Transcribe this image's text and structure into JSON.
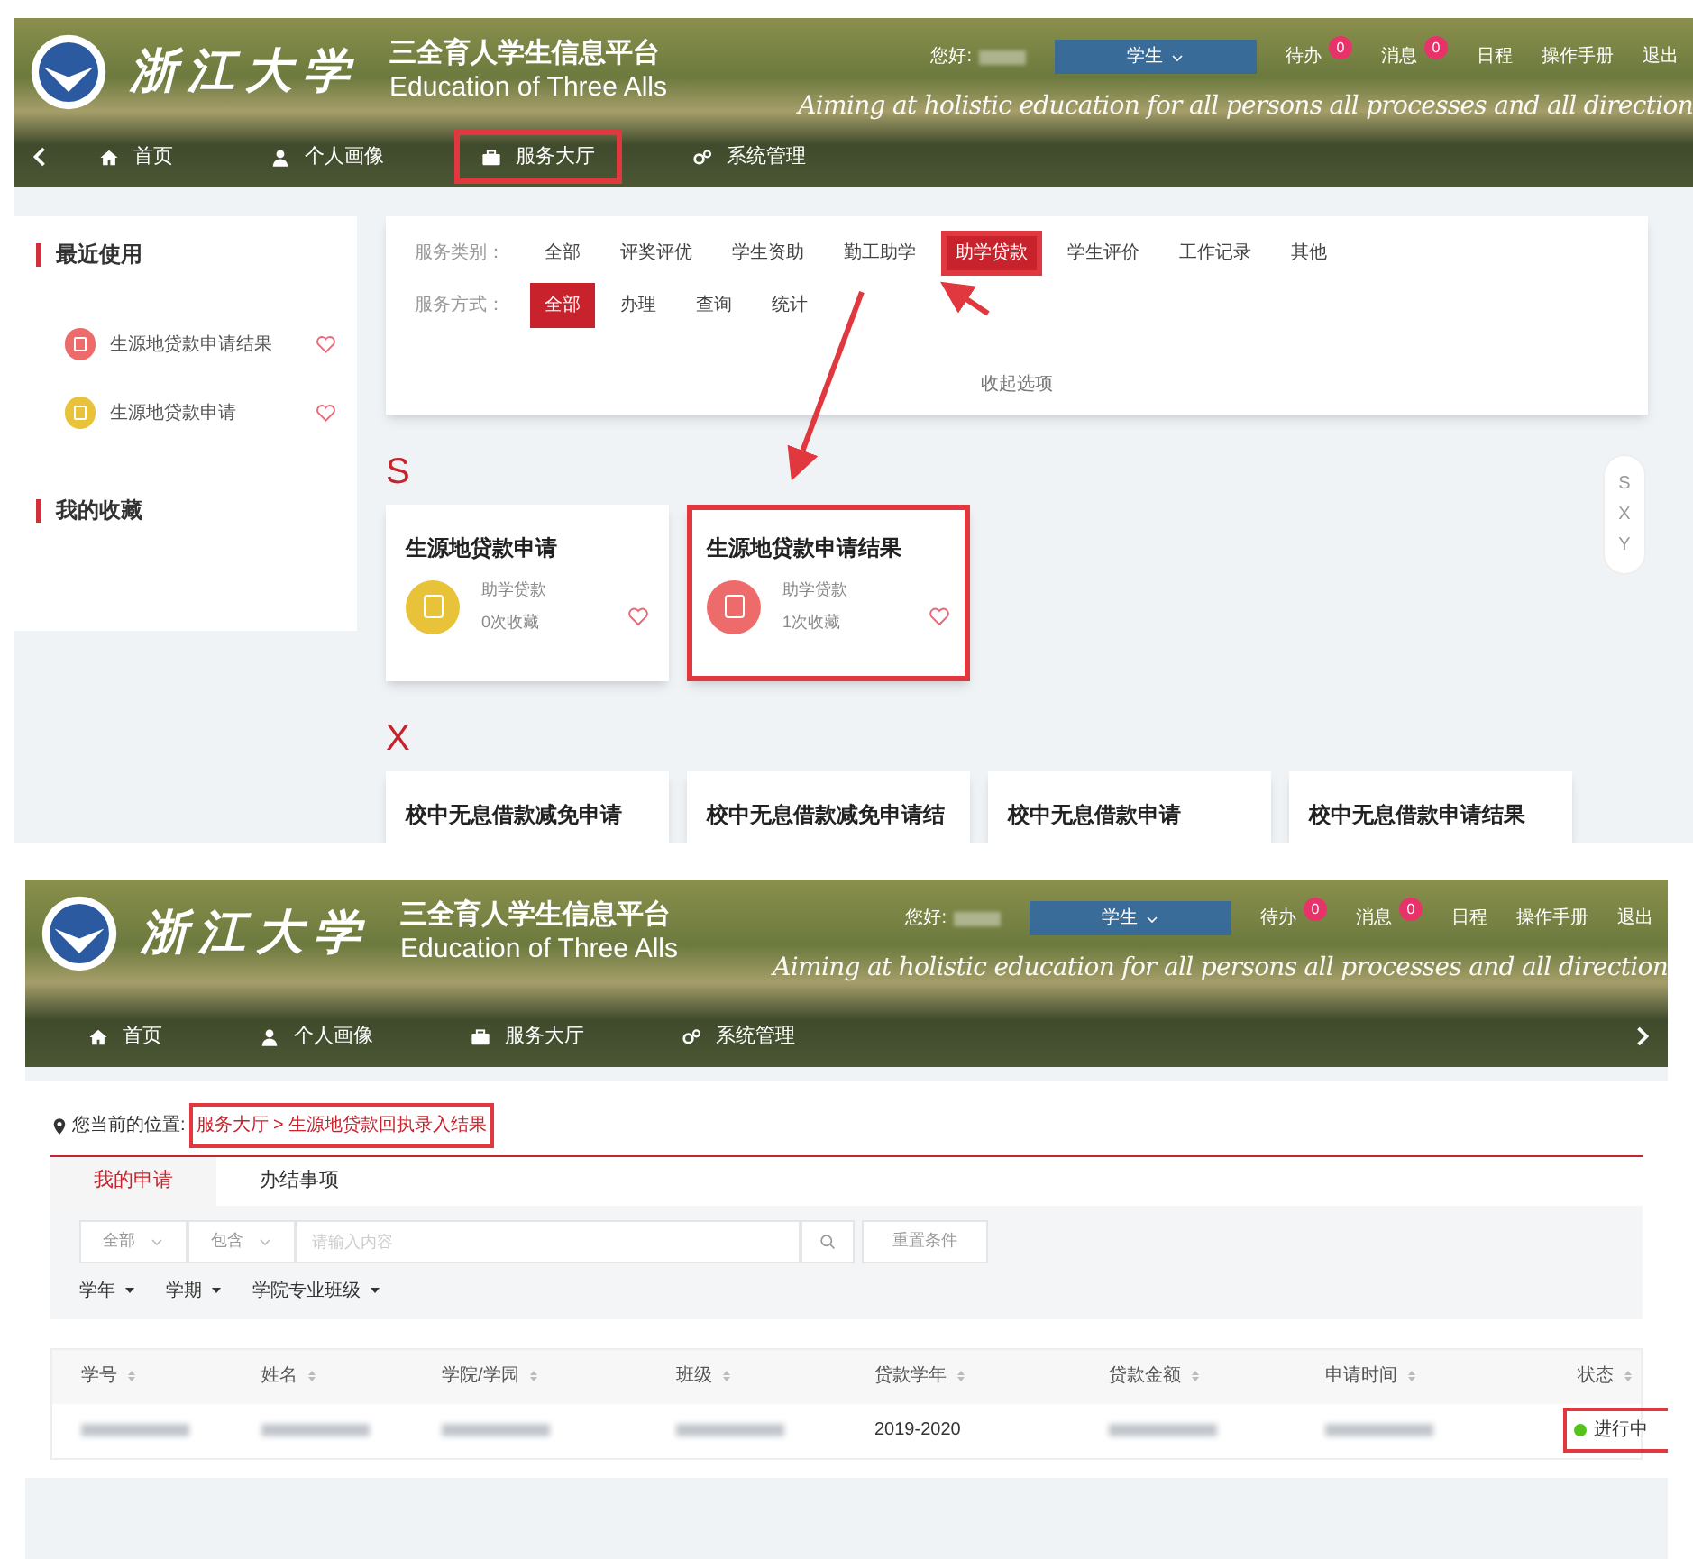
{
  "top_screen": {
    "header": {
      "logo_text": "浙江大学",
      "title": "三全育人学生信息平台",
      "subtitle": "Education of Three Alls",
      "greeting": "您好:",
      "role": "学生",
      "links": [
        {
          "label": "待办",
          "badge": "0"
        },
        {
          "label": "消息",
          "badge": "0"
        },
        {
          "label": "日程"
        },
        {
          "label": "操作手册"
        },
        {
          "label": "退出"
        }
      ],
      "slogan": "Aiming at holistic education for all persons all processes and all direction",
      "nav": [
        {
          "label": "首页",
          "highlighted": false
        },
        {
          "label": "个人画像",
          "highlighted": false
        },
        {
          "label": "服务大厅",
          "highlighted": true
        },
        {
          "label": "系统管理",
          "highlighted": false
        }
      ],
      "back_arrow": true
    },
    "sidebar": {
      "recent_title": "最近使用",
      "recent": [
        {
          "label": "生源地贷款申请结果",
          "color": "#ee6b6b"
        },
        {
          "label": "生源地贷款申请",
          "color": "#e8c33a"
        }
      ],
      "favorites_title": "我的收藏"
    },
    "filters": {
      "rows": [
        {
          "label": "服务类别：",
          "options": [
            {
              "label": "全部",
              "selected": false,
              "highlighted": false
            },
            {
              "label": "评奖评优",
              "selected": false,
              "highlighted": false
            },
            {
              "label": "学生资助",
              "selected": false,
              "highlighted": false
            },
            {
              "label": "勤工助学",
              "selected": false,
              "highlighted": false
            },
            {
              "label": "助学贷款",
              "selected": true,
              "highlighted": true
            },
            {
              "label": "学生评价",
              "selected": false,
              "highlighted": false
            },
            {
              "label": "工作记录",
              "selected": false,
              "highlighted": false
            },
            {
              "label": "其他",
              "selected": false,
              "highlighted": false
            }
          ]
        },
        {
          "label": "服务方式：",
          "options": [
            {
              "label": "全部",
              "selected": true,
              "highlighted": false
            },
            {
              "label": "办理",
              "selected": false,
              "highlighted": false
            },
            {
              "label": "查询",
              "selected": false,
              "highlighted": false
            },
            {
              "label": "统计",
              "selected": false,
              "highlighted": false
            }
          ]
        }
      ],
      "collapse": "收起选项"
    },
    "sections": [
      {
        "letter": "S",
        "cards": [
          {
            "title": "生源地贷款申请",
            "category": "助学贷款",
            "count": "0次收藏",
            "color": "#e8c33a",
            "highlighted": false
          },
          {
            "title": "生源地贷款申请结果",
            "category": "助学贷款",
            "count": "1次收藏",
            "color": "#ee6b6b",
            "highlighted": true
          }
        ]
      },
      {
        "letter": "X",
        "cards": [
          {
            "title": "校中无息借款减免申请",
            "highlighted": false
          },
          {
            "title": "校中无息借款减免申请结",
            "highlighted": false
          },
          {
            "title": "校中无息借款申请",
            "highlighted": false
          },
          {
            "title": "校中无息借款申请结果",
            "highlighted": false
          }
        ]
      }
    ],
    "index_nav": [
      "S",
      "X",
      "Y"
    ]
  },
  "bottom_screen": {
    "header": {
      "logo_text": "浙江大学",
      "title": "三全育人学生信息平台",
      "subtitle": "Education of Three Alls",
      "greeting": "您好:",
      "role": "学生",
      "links": [
        {
          "label": "待办",
          "badge": "0"
        },
        {
          "label": "消息",
          "badge": "0"
        },
        {
          "label": "日程"
        },
        {
          "label": "操作手册"
        },
        {
          "label": "退出"
        }
      ],
      "slogan": "Aiming at holistic education for all persons all processes and all direction",
      "nav": [
        {
          "label": "首页",
          "highlighted": false
        },
        {
          "label": "个人画像",
          "highlighted": false
        },
        {
          "label": "服务大厅",
          "highlighted": false
        },
        {
          "label": "系统管理",
          "highlighted": false
        }
      ],
      "back_arrow": false
    },
    "breadcrumb": {
      "label": "您当前的位置:",
      "path": "服务大厅 > 生源地贷款回执录入结果",
      "highlighted": true
    },
    "tabs": [
      {
        "label": "我的申请",
        "selected": true
      },
      {
        "label": "办结事项",
        "selected": false
      }
    ],
    "search": {
      "scope": "全部",
      "match": "包含",
      "placeholder": "请输入内容",
      "reset": "重置条件"
    },
    "dropdowns": [
      "学年",
      "学期",
      "学院专业班级"
    ],
    "table": {
      "columns": [
        "学号",
        "姓名",
        "学院/学园",
        "班级",
        "贷款学年",
        "贷款金额",
        "申请时间",
        "状态"
      ],
      "rows": [
        {
          "cells": [
            {
              "redacted": true
            },
            {
              "redacted": true
            },
            {
              "redacted": true
            },
            {
              "redacted": true
            },
            {
              "text": "2019-2020"
            },
            {
              "redacted": true
            },
            {
              "redacted": true
            },
            {
              "kind": "status",
              "text": "进行中",
              "color": "#52c41a",
              "highlighted": true
            }
          ]
        }
      ]
    }
  }
}
